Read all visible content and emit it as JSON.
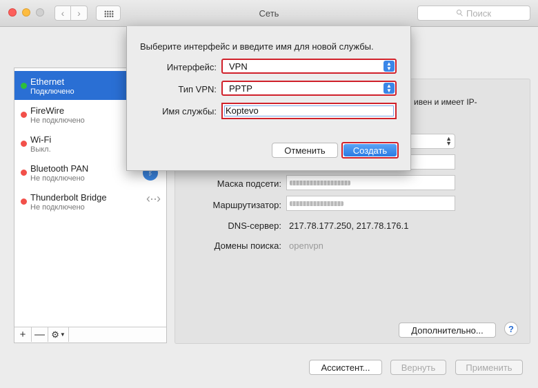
{
  "window": {
    "title": "Сеть"
  },
  "search": {
    "placeholder": "Поиск"
  },
  "services": [
    {
      "name": "Ethernet",
      "status": "Подключено",
      "color": "#2dbf3c",
      "selected": true
    },
    {
      "name": "FireWire",
      "status": "Не подключено",
      "color": "#f2504a"
    },
    {
      "name": "Wi-Fi",
      "status": "Выкл.",
      "color": "#f2504a"
    },
    {
      "name": "Bluetooth PAN",
      "status": "Не подключено",
      "color": "#f2504a"
    },
    {
      "name": "Thunderbolt Bridge",
      "status": "Не подключено",
      "color": "#f2504a"
    }
  ],
  "sidebar_toolbar": {
    "add": "+",
    "remove": "—",
    "gear": "⚙"
  },
  "detail": {
    "partial_text_line1": "ивен и имеет IP-",
    "subnet_label": "Маска подсети:",
    "router_label": "Маршрутизатор:",
    "dns_label": "DNS-сервер:",
    "dns_value": "217.78.177.250, 217.78.176.1",
    "search_domains_label": "Домены поиска:",
    "search_domains_value": "openvpn",
    "advanced_button": "Дополнительно...",
    "help": "?"
  },
  "footer": {
    "assistant": "Ассистент...",
    "revert": "Вернуть",
    "apply": "Применить"
  },
  "sheet": {
    "message": "Выберите интерфейс и введите имя для новой службы.",
    "interface_label": "Интерфейс:",
    "interface_value": "VPN",
    "vpn_type_label": "Тип VPN:",
    "vpn_type_value": "PPTP",
    "service_name_label": "Имя службы:",
    "service_name_value": "Koptevo",
    "cancel": "Отменить",
    "create": "Создать"
  }
}
